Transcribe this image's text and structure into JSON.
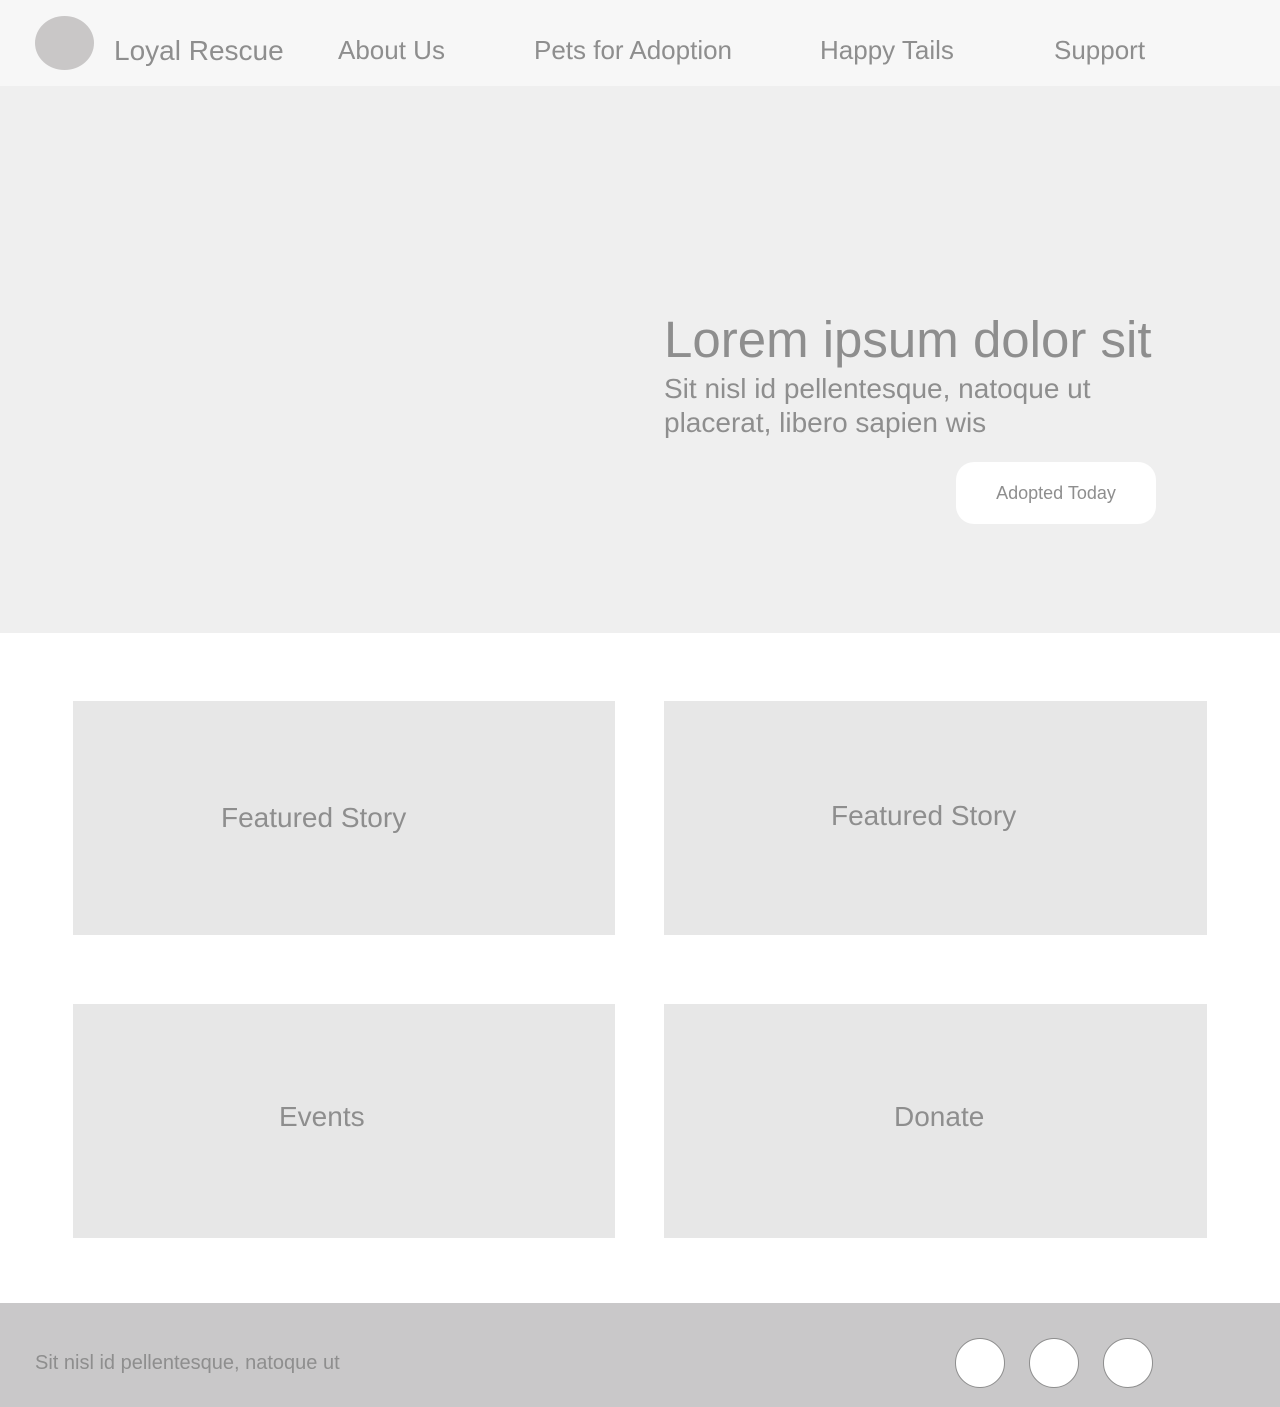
{
  "header": {
    "brand": "Loyal Rescue",
    "nav": {
      "about": "About Us",
      "pets": "Pets for Adoption",
      "tails": "Happy Tails",
      "support": "Support"
    }
  },
  "hero": {
    "title": "Lorem ipsum dolor sit",
    "subtitle": "Sit nisl id pellentesque, natoque ut placerat, libero sapien wis",
    "button_label": "Adopted Today"
  },
  "cards": {
    "card1": "Featured Story",
    "card2": "Featured Story",
    "card3": "Events",
    "card4": "Donate"
  },
  "footer": {
    "text": "Sit nisl id pellentesque, natoque ut"
  },
  "colors": {
    "header_bg": "#f7f7f7",
    "hero_bg": "#efefef",
    "card_bg": "#e7e7e7",
    "footer_bg": "#c9c8c9",
    "text": "#8e8e8e",
    "logo": "#c9c7c7"
  }
}
